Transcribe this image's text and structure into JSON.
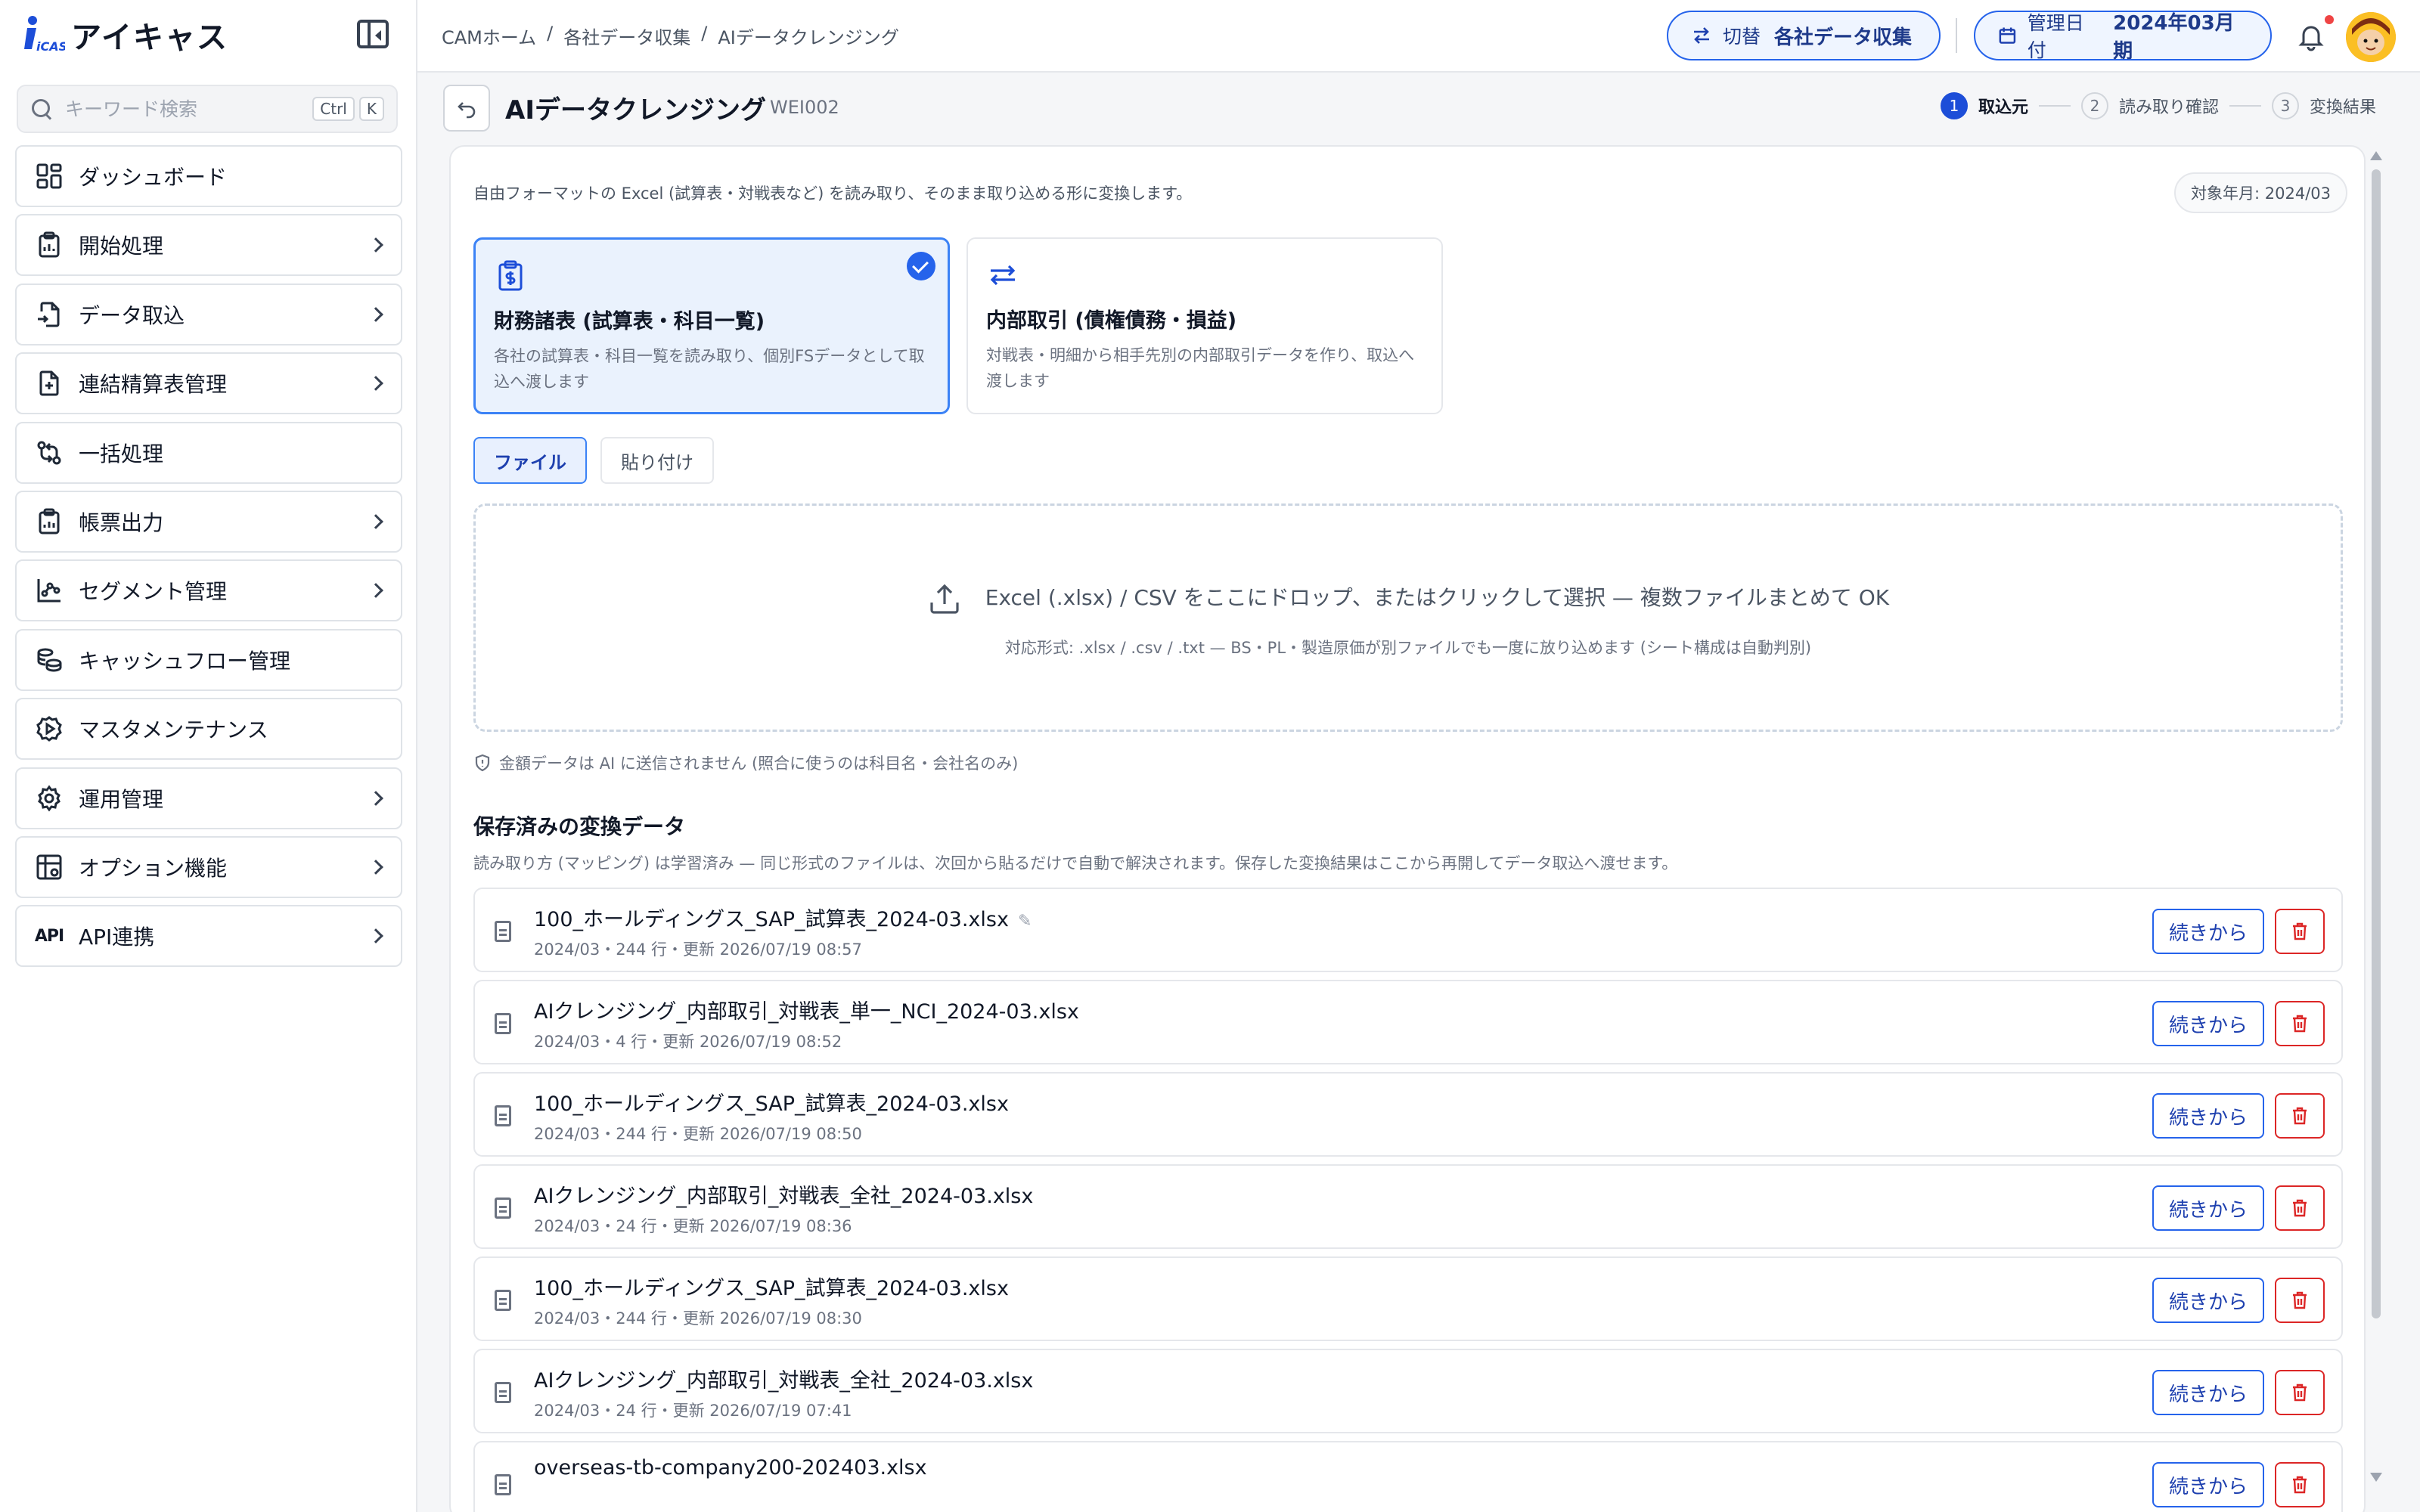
{
  "app": {
    "brand_name": "アイキャス",
    "brand_mark": "iCAS"
  },
  "search": {
    "placeholder": "キーワード検索",
    "shortcut_mod": "Ctrl",
    "shortcut_key": "K"
  },
  "sidebar": {
    "items": [
      {
        "label": "ダッシュボード",
        "icon": "dashboard-icon",
        "has_children": false
      },
      {
        "label": "開始処理",
        "icon": "clipboard-icon",
        "has_children": true
      },
      {
        "label": "データ取込",
        "icon": "file-import-icon",
        "has_children": true
      },
      {
        "label": "連結精算表管理",
        "icon": "file-plus-icon",
        "has_children": true
      },
      {
        "label": "一括処理",
        "icon": "git-compare-icon",
        "has_children": false
      },
      {
        "label": "帳票出力",
        "icon": "report-icon",
        "has_children": true
      },
      {
        "label": "セグメント管理",
        "icon": "chart-icon",
        "has_children": true
      },
      {
        "label": "キャッシュフロー管理",
        "icon": "coins-icon",
        "has_children": false
      },
      {
        "label": "マスタメンテナンス",
        "icon": "gear-play-icon",
        "has_children": false
      },
      {
        "label": "運用管理",
        "icon": "gear-icon",
        "has_children": true
      },
      {
        "label": "オプション機能",
        "icon": "grid-gear-icon",
        "has_children": true
      },
      {
        "label": "API連携",
        "icon": "api-icon",
        "icon_text": "API",
        "has_children": true
      }
    ]
  },
  "header": {
    "breadcrumb": [
      "CAMホーム",
      "各社データ収集",
      "AIデータクレンジング"
    ],
    "breadcrumb_sep": "/",
    "switch_label": "切替",
    "switch_value": "各社データ収集",
    "date_label": "管理日付",
    "date_value": "2024年03月期"
  },
  "page": {
    "title": "AIデータクレンジング",
    "code": "WEI002",
    "steps": [
      {
        "num": "1",
        "label": "取込元",
        "active": true
      },
      {
        "num": "2",
        "label": "読み取り確認",
        "active": false
      },
      {
        "num": "3",
        "label": "変換結果",
        "active": false
      }
    ]
  },
  "main": {
    "description": "自由フォーマットの Excel (試算表・対戦表など) を読み取り、そのまま取り込める形に変換します。",
    "target_period": "対象年月: 2024/03",
    "options": [
      {
        "title": "財務諸表 (試算表・科目一覧)",
        "desc": "各社の試算表・科目一覧を読み取り、個別FSデータとして取込へ渡します",
        "selected": true
      },
      {
        "title": "内部取引 (債権債務・損益)",
        "desc": "対戦表・明細から相手先別の内部取引データを作り、取込へ渡します",
        "selected": false
      }
    ],
    "tabs": {
      "file": "ファイル",
      "paste": "貼り付け"
    },
    "dropzone": {
      "main": "Excel (.xlsx) / CSV をここにドロップ、またはクリックして選択 — 複数ファイルまとめて OK",
      "sub": "対応形式: .xlsx / .csv / .txt — BS・PL・製造原価が別ファイルでも一度に放り込めます (シート構成は自動判別)"
    },
    "privacy_note": "金額データは AI に送信されません (照合に使うのは科目名・会社名のみ)",
    "saved": {
      "title": "保存済みの変換データ",
      "desc": "読み取り方 (マッピング) は学習済み — 同じ形式のファイルは、次回から貼るだけで自動で解決されます。保存した変換結果はここから再開してデータ取込へ渡せます。",
      "continue_label": "続きから",
      "files": [
        {
          "name": "100_ホールディングス_SAP_試算表_2024-03.xlsx",
          "meta": "2024/03・244 行・更新 2026/07/19 08:57",
          "editable": true
        },
        {
          "name": "AIクレンジング_内部取引_対戦表_単一_NCI_2024-03.xlsx",
          "meta": "2024/03・4 行・更新 2026/07/19 08:52",
          "editable": false
        },
        {
          "name": "100_ホールディングス_SAP_試算表_2024-03.xlsx",
          "meta": "2024/03・244 行・更新 2026/07/19 08:50",
          "editable": false
        },
        {
          "name": "AIクレンジング_内部取引_対戦表_全社_2024-03.xlsx",
          "meta": "2024/03・24 行・更新 2026/07/19 08:36",
          "editable": false
        },
        {
          "name": "100_ホールディングス_SAP_試算表_2024-03.xlsx",
          "meta": "2024/03・244 行・更新 2026/07/19 08:30",
          "editable": false
        },
        {
          "name": "AIクレンジング_内部取引_対戦表_全社_2024-03.xlsx",
          "meta": "2024/03・24 行・更新 2026/07/19 07:41",
          "editable": false
        },
        {
          "name": "overseas-tb-company200-202403.xlsx",
          "meta": "",
          "editable": false
        }
      ]
    }
  },
  "colors": {
    "accent": "#2563eb",
    "danger": "#dc2626",
    "selected_bg": "#eaf2fd"
  }
}
